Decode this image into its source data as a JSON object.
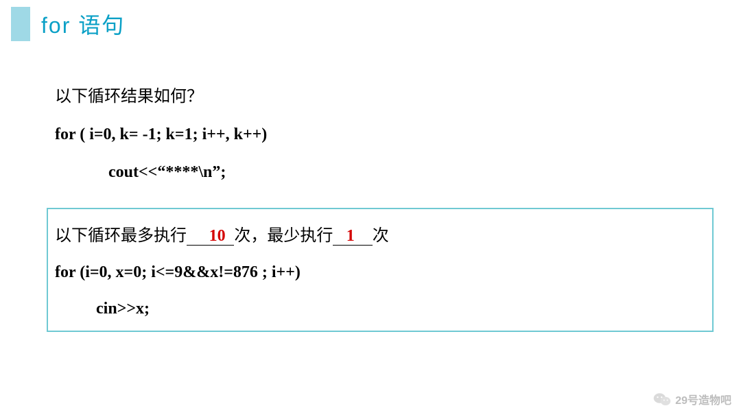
{
  "title": "for  语句",
  "section1": {
    "question": "以下循环结果如何？",
    "code_line1": "for ( i=0, k= -1; k=1; i++, k++)",
    "code_line2": "cout<<“****\\n”;"
  },
  "section2": {
    "fill_prefix": "以下循环最多执行",
    "blank1_u1": "    ",
    "answer1": "10",
    "blank1_u2": " ",
    "fill_mid1": "次，最少执行",
    "blank2_u1": "  ",
    "answer2": "1",
    "blank2_u2": "   ",
    "fill_suffix": "次",
    "code_line1": "for (i=0, x=0; i<=9&&x!=876 ; i++)",
    "code_line2": "cin>>x;"
  },
  "watermark": {
    "text": "29号造物吧"
  }
}
